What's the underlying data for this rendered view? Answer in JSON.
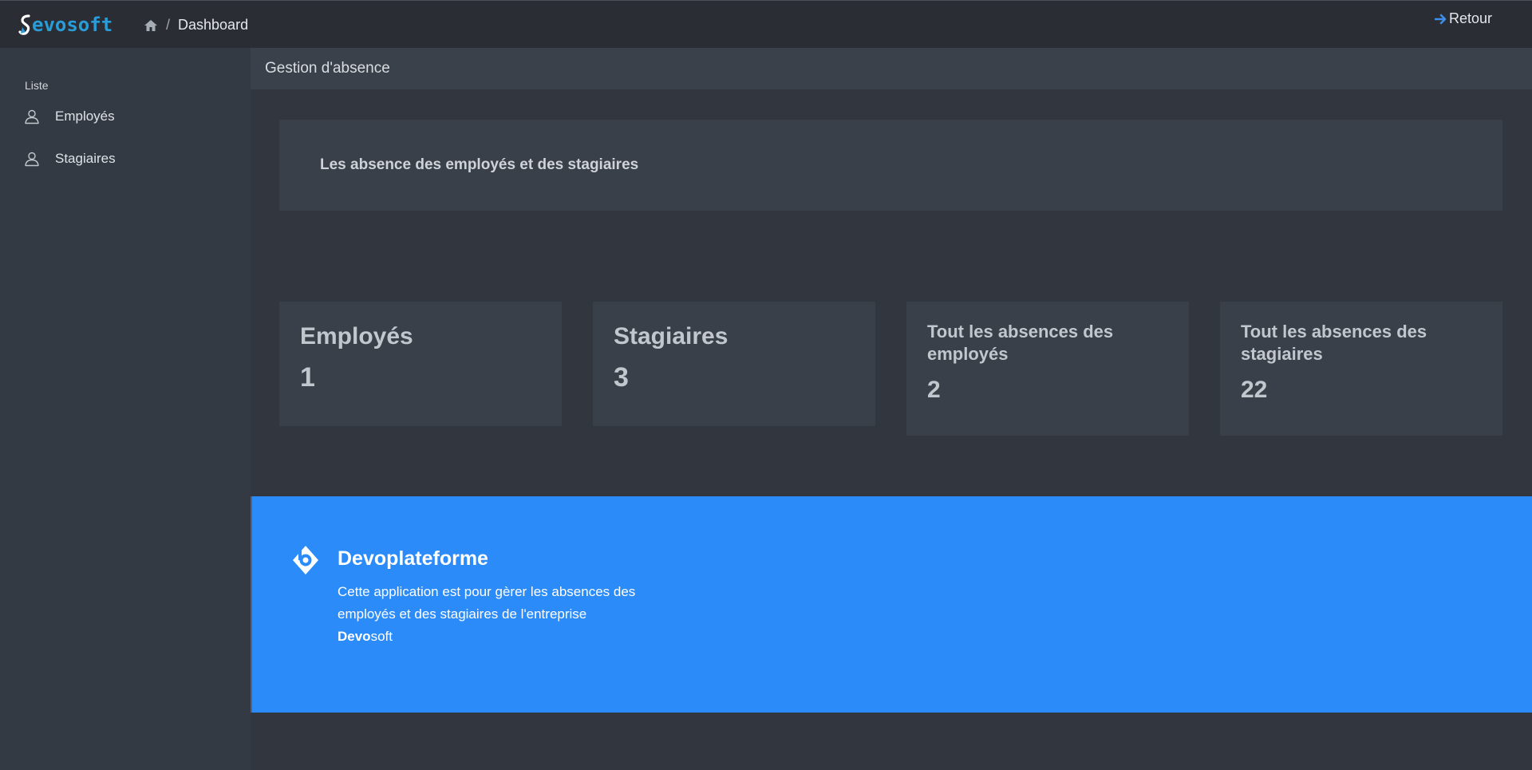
{
  "brand": {
    "logo_text": "evosoft",
    "accent": "#2a9cd8"
  },
  "header": {
    "breadcrumb": {
      "home_icon": "home-icon",
      "separator": "/",
      "current": "Dashboard"
    },
    "back_label": "Retour"
  },
  "sidebar": {
    "section_title": "Liste",
    "items": [
      {
        "label": "Employés",
        "icon": "user-icon"
      },
      {
        "label": "Stagiaires",
        "icon": "user-icon"
      }
    ]
  },
  "subheader": {
    "title": "Gestion d'absence"
  },
  "intro": {
    "text": "Les absence des employés et des stagiaires"
  },
  "stats": [
    {
      "title": "Employés",
      "value": "1"
    },
    {
      "title": "Stagiaires",
      "value": "3"
    },
    {
      "title": "Tout les absences des employés",
      "value": "2"
    },
    {
      "title": "Tout les absences des stagiaires",
      "value": "22"
    }
  ],
  "banner": {
    "title_bold": "Devo",
    "title_rest": "plateforme",
    "description": "Cette application est pour gèrer les absences des employés et des stagiaires de l'entreprise",
    "company_bold": "Devo",
    "company_rest": "soft",
    "color": "#2b8bf9"
  }
}
